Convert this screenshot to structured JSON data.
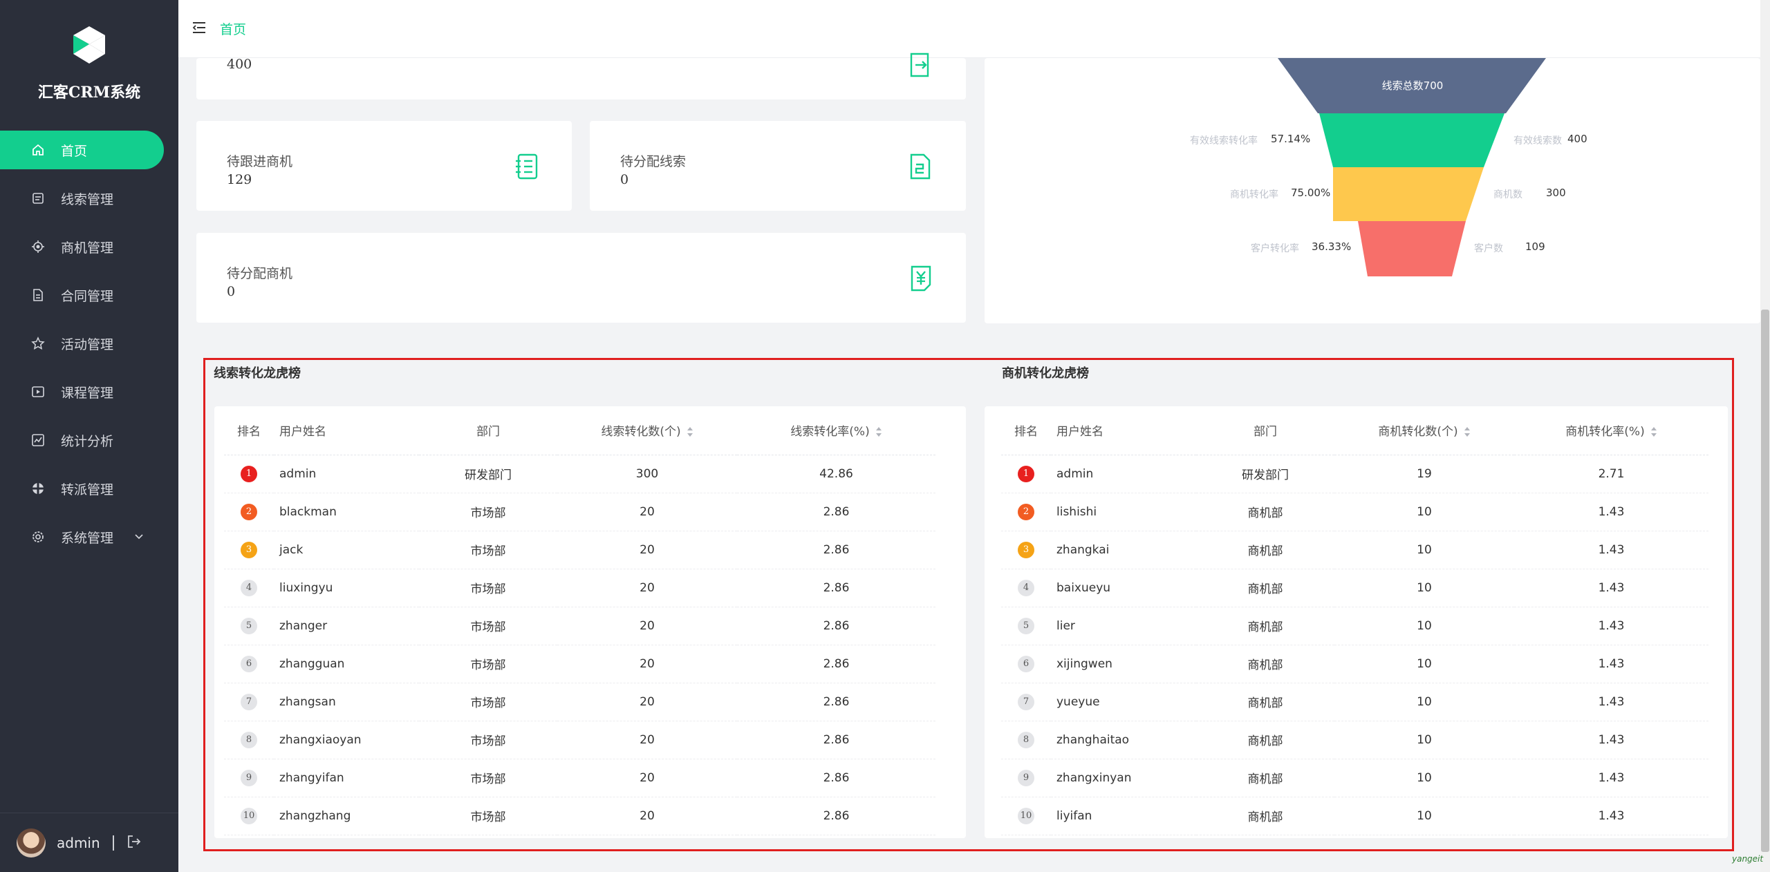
{
  "app": {
    "title": "汇客CRM系统"
  },
  "sidebar": {
    "items": [
      {
        "label": "首页",
        "icon": "home-icon",
        "active": true
      },
      {
        "label": "线索管理",
        "icon": "clue-icon"
      },
      {
        "label": "商机管理",
        "icon": "business-icon"
      },
      {
        "label": "合同管理",
        "icon": "contract-icon"
      },
      {
        "label": "活动管理",
        "icon": "activity-icon"
      },
      {
        "label": "课程管理",
        "icon": "course-icon"
      },
      {
        "label": "统计分析",
        "icon": "stats-icon"
      },
      {
        "label": "转派管理",
        "icon": "transfer-icon"
      },
      {
        "label": "系统管理",
        "icon": "settings-icon",
        "has_children": true
      }
    ],
    "user": {
      "name": "admin"
    }
  },
  "header": {
    "breadcrumb": "首页"
  },
  "stats": {
    "top_value": "400",
    "pending_followup_biz": {
      "label": "待跟进商机",
      "value": "129"
    },
    "pending_assign_clue": {
      "label": "待分配线索",
      "value": "0"
    },
    "pending_assign_biz": {
      "label": "待分配商机",
      "value": "0"
    }
  },
  "funnel": {
    "stage_total": "线索总数700",
    "valid_rate_label": "有效线索转化率",
    "valid_rate": "57.14%",
    "valid_count_label": "有效线索数",
    "valid_count": "400",
    "biz_rate_label": "商机转化率",
    "biz_rate": "75.00%",
    "biz_count_label": "商机数",
    "biz_count": "300",
    "cust_rate_label": "客户转化率",
    "cust_rate": "36.33%",
    "cust_count_label": "客户数",
    "cust_count": "109",
    "colors": [
      "#5b6b8c",
      "#13ce8e",
      "#fec84d",
      "#f76f6a"
    ]
  },
  "clue_rank": {
    "title": "线索转化龙虎榜",
    "headers": [
      "排名",
      "用户姓名",
      "部门",
      "线索转化数(个)",
      "线索转化率(%)"
    ],
    "rows": [
      {
        "rank": "1",
        "name": "admin",
        "dept": "研发部门",
        "count": "300",
        "rate": "42.86"
      },
      {
        "rank": "2",
        "name": "blackman",
        "dept": "市场部",
        "count": "20",
        "rate": "2.86"
      },
      {
        "rank": "3",
        "name": "jack",
        "dept": "市场部",
        "count": "20",
        "rate": "2.86"
      },
      {
        "rank": "4",
        "name": "liuxingyu",
        "dept": "市场部",
        "count": "20",
        "rate": "2.86"
      },
      {
        "rank": "5",
        "name": "zhanger",
        "dept": "市场部",
        "count": "20",
        "rate": "2.86"
      },
      {
        "rank": "6",
        "name": "zhangguan",
        "dept": "市场部",
        "count": "20",
        "rate": "2.86"
      },
      {
        "rank": "7",
        "name": "zhangsan",
        "dept": "市场部",
        "count": "20",
        "rate": "2.86"
      },
      {
        "rank": "8",
        "name": "zhangxiaoyan",
        "dept": "市场部",
        "count": "20",
        "rate": "2.86"
      },
      {
        "rank": "9",
        "name": "zhangyifan",
        "dept": "市场部",
        "count": "20",
        "rate": "2.86"
      },
      {
        "rank": "10",
        "name": "zhangzhang",
        "dept": "市场部",
        "count": "20",
        "rate": "2.86"
      }
    ]
  },
  "biz_rank": {
    "title": "商机转化龙虎榜",
    "headers": [
      "排名",
      "用户姓名",
      "部门",
      "商机转化数(个)",
      "商机转化率(%)"
    ],
    "rows": [
      {
        "rank": "1",
        "name": "admin",
        "dept": "研发部门",
        "count": "19",
        "rate": "2.71"
      },
      {
        "rank": "2",
        "name": "lishishi",
        "dept": "商机部",
        "count": "10",
        "rate": "1.43"
      },
      {
        "rank": "3",
        "name": "zhangkai",
        "dept": "商机部",
        "count": "10",
        "rate": "1.43"
      },
      {
        "rank": "4",
        "name": "baixueyu",
        "dept": "商机部",
        "count": "10",
        "rate": "1.43"
      },
      {
        "rank": "5",
        "name": "lier",
        "dept": "商机部",
        "count": "10",
        "rate": "1.43"
      },
      {
        "rank": "6",
        "name": "xijingwen",
        "dept": "商机部",
        "count": "10",
        "rate": "1.43"
      },
      {
        "rank": "7",
        "name": "yueyue",
        "dept": "商机部",
        "count": "10",
        "rate": "1.43"
      },
      {
        "rank": "8",
        "name": "zhanghaitao",
        "dept": "商机部",
        "count": "10",
        "rate": "1.43"
      },
      {
        "rank": "9",
        "name": "zhangxinyan",
        "dept": "商机部",
        "count": "10",
        "rate": "1.43"
      },
      {
        "rank": "10",
        "name": "liyifan",
        "dept": "商机部",
        "count": "10",
        "rate": "1.43"
      }
    ]
  },
  "watermark": "yangeit"
}
